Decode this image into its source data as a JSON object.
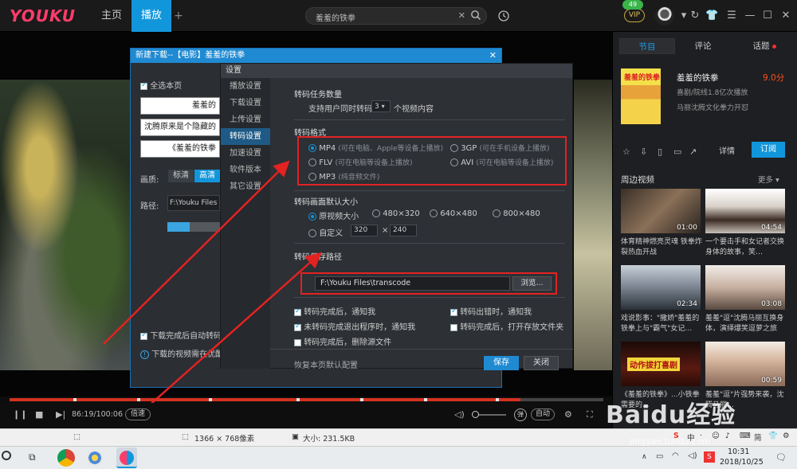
{
  "topbar": {
    "logo": "YOUKU",
    "tabs": [
      {
        "label": "主页"
      },
      {
        "label": "播放"
      }
    ],
    "add_tab": "+",
    "search_value": "羞羞的铁拳",
    "vip_label": "VIP",
    "vip_count": "49"
  },
  "download_dialog": {
    "title": "新建下载--【电影】羞羞的铁拳",
    "select_all": "全选本页",
    "items": [
      "羞羞的",
      "沈腾原来是个隐藏的",
      "《羞羞的铁拳"
    ],
    "quality_label": "画质:",
    "quality_std": "标清",
    "quality_hd": "高清",
    "path_label": "路径:",
    "path_value": "F:\\Youku Files",
    "progress_fraction": 0.42,
    "auto_transcode": "下载完成后自动转码",
    "notice": "下载的视频需在优酷"
  },
  "settings": {
    "title": "设置",
    "sidebar": [
      {
        "label": "播放设置"
      },
      {
        "label": "下载设置"
      },
      {
        "label": "上传设置"
      },
      {
        "label": "转码设置"
      },
      {
        "label": "加速设置"
      },
      {
        "label": "软件版本"
      },
      {
        "label": "其它设置"
      }
    ],
    "task_section": "转码任务数量",
    "task_prefix": "支持用户同时转码",
    "task_value": "3",
    "task_suffix": "个视频内容",
    "format_section": "转码格式",
    "formats": [
      {
        "name": "MP4",
        "hint": "(可在电脑、Apple等设备上播放)"
      },
      {
        "name": "3GP",
        "hint": "(可在手机设备上播放)"
      },
      {
        "name": "FLV",
        "hint": "(可在电脑等设备上播放)"
      },
      {
        "name": "AVI",
        "hint": "(可在电脑等设备上播放)"
      },
      {
        "name": "MP3",
        "hint": "(纯音频文件)"
      }
    ],
    "size_section": "转码画面默认大小",
    "sizes": [
      "原视频大小",
      "480×320",
      "640×480",
      "800×480"
    ],
    "custom_label": "自定义",
    "custom_w": "320",
    "custom_h": "240",
    "custom_x": "×",
    "path_section": "转码保存路径",
    "path_value": "F:\\Youku Files\\transcode",
    "browse": "浏览...",
    "options": [
      "转码完成后，通知我",
      "转码出错时，通知我",
      "未转码完成退出程序时，通知我",
      "转码完成后，打开存放文件夹",
      "转码完成后，删除源文件"
    ],
    "restore": "恢复本页默认配置",
    "save": "保存",
    "close": "关闭"
  },
  "player": {
    "time": "86:19/100:06",
    "speed": "倍速",
    "bullet": "弹",
    "auto": "自动",
    "progress_fraction": 0.86
  },
  "right_panel": {
    "tabs": [
      {
        "label": "节目"
      },
      {
        "label": "评论"
      },
      {
        "label": "话题"
      }
    ],
    "poster_title": "羞羞的铁拳",
    "movie_title": "羞羞的铁拳",
    "score": "9.0分",
    "genre": "喜剧/院线1.8亿次播放",
    "cast": "马丽沈腾文化拳力开怼",
    "detail": "详情",
    "subscribe": "订阅",
    "related_title": "周边视频",
    "more": "更多",
    "videos": [
      {
        "duration": "01:00",
        "caption": "体育精神燃亮灵魂 铁拳炸裂热血开战",
        "color": "#6a5a45"
      },
      {
        "duration": "04:54",
        "caption": "一个要击手和女记者交换身体的故事，笑…",
        "color": "#b8b2ac"
      },
      {
        "duration": "02:34",
        "caption": "戏说影事：\"撒娇\"羞羞的铁拳上与\"霸气\"女记…",
        "color": "#9aa4b0"
      },
      {
        "duration": "03:08",
        "caption": "羞羞\"逗\"沈腾马丽互换身体，演绎爆笑逗萝之旅",
        "color": "#d8d0c8"
      },
      {
        "duration": "",
        "caption": "《羞羞的铁拳》...小铁拳需要的...",
        "color": "#2a1a14",
        "thumb_text": "动作拔打喜剧"
      },
      {
        "duration": "00:59",
        "caption": "羞羞\"逗\"片强势来袭，沈腾马丽…",
        "color": "#e8d8c8"
      }
    ]
  },
  "statusbar": {
    "resolution": "1366 × 768像素",
    "size": "大小: 231.5KB"
  },
  "taskbar": {
    "time": "10:31",
    "date": "2018/10/25"
  },
  "watermark": "Baidu经验",
  "watermark_sub": "jingyan.baidu.com"
}
